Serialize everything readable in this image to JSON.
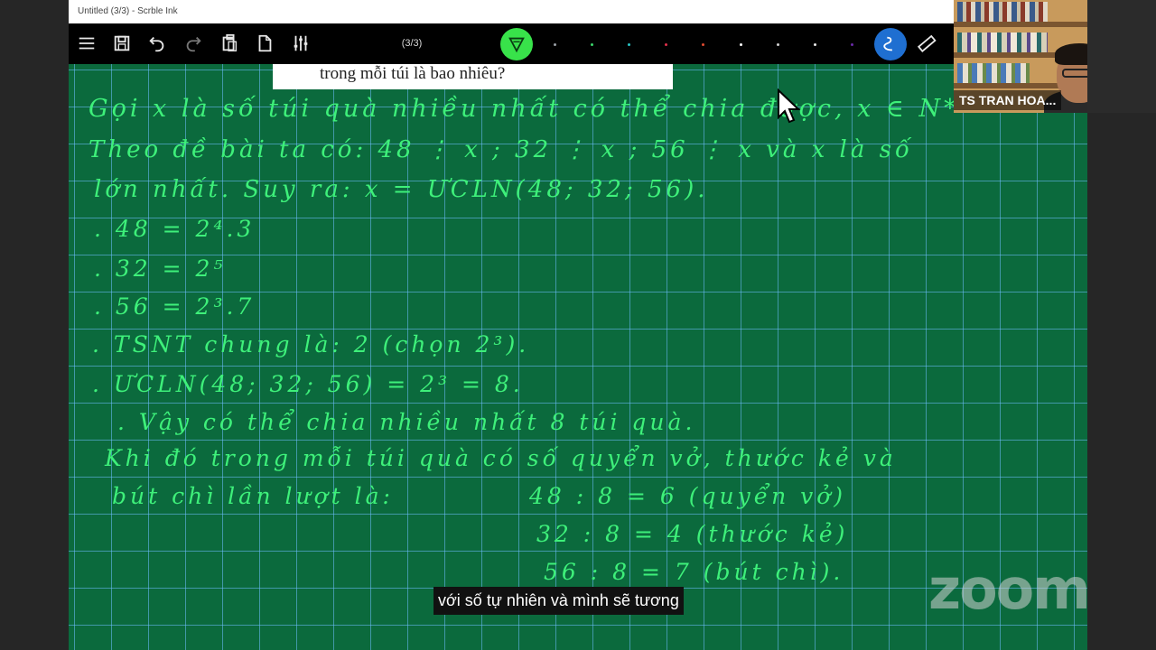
{
  "window": {
    "title": "Untitled (3/3) - Scrble Ink"
  },
  "toolbar": {
    "page_indicator": "(3/3)",
    "pen_colors": [
      "#38e24a",
      "#9aa0a6",
      "#3ad36a",
      "#28c4c4",
      "#e0304a",
      "#e04a30",
      "#ffffff",
      "#d0d0d0",
      "#e8e8e8",
      "#6a2aa8",
      "#1f6fd1"
    ]
  },
  "board": {
    "problem_text": "trong mỗi túi là bao nhiêu?",
    "handwriting": [
      "Gọi x là số túi quà nhiều nhất có thể chia được, x ∈ N*",
      "Theo đề bài ta có: 48 ⋮ x ; 32 ⋮ x ; 56 ⋮ x và x là số",
      "lớn nhất. Suy ra: x = ƯCLN(48; 32; 56).",
      ". 48 = 2⁴.3",
      ". 32 = 2⁵",
      ". 56 = 2³.7",
      ". TSNT chung là: 2 (chọn 2³).",
      ". ƯCLN(48; 32; 56) = 2³ = 8.",
      ". Vậy có thể chia nhiều nhất 8 túi quà.",
      "Khi đó trong mỗi túi quà có số quyển vở, thước kẻ và",
      "bút chì lần lượt là:",
      "48 : 8 = 6 (quyển vở)",
      "32 : 8 = 4 (thước kẻ)",
      "56 : 8 = 7 (bút chì)."
    ]
  },
  "webcam": {
    "name": "TS TRAN HOA..."
  },
  "caption": {
    "text": "với số tự nhiên và mình sẽ tương"
  },
  "watermark": {
    "text": "zoom"
  }
}
